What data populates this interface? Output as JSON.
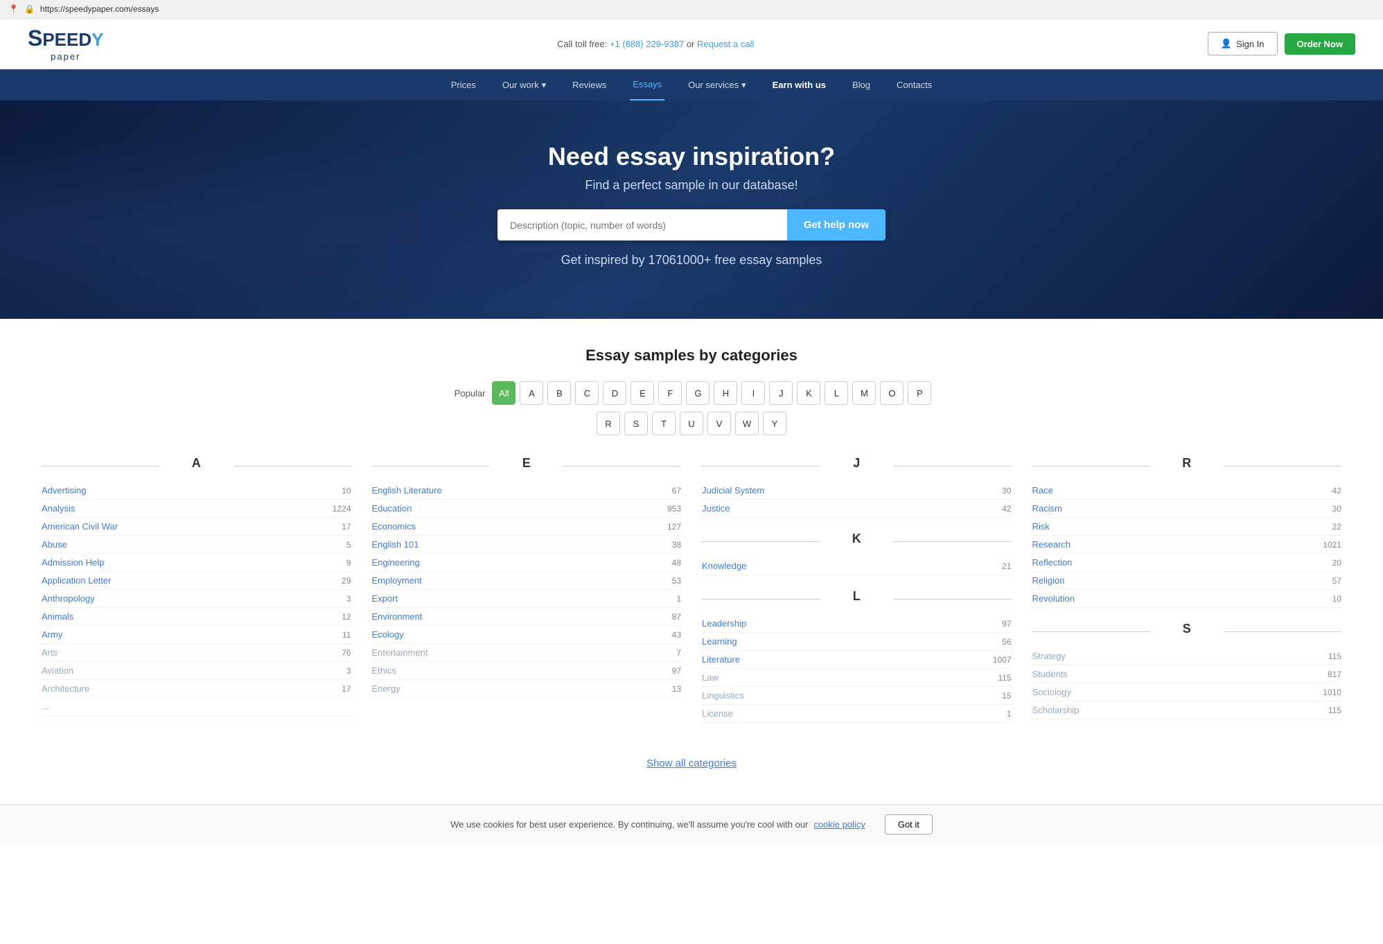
{
  "browser": {
    "url": "https://speedypaper.com/essays",
    "lock_icon": "🔒"
  },
  "header": {
    "logo_s": "S",
    "logo_peed": "PEED",
    "logo_ey": "Y",
    "logo_paper": "paper",
    "call_prefix": "Call toll free:",
    "phone": "+1 (888) 229-9387",
    "or": "or",
    "request_call": "Request a call",
    "signin_label": "Sign In",
    "order_label": "Order Now"
  },
  "nav": {
    "items": [
      {
        "label": "Prices",
        "href": "#",
        "active": false
      },
      {
        "label": "Our work",
        "href": "#",
        "active": false,
        "dropdown": true
      },
      {
        "label": "Reviews",
        "href": "#",
        "active": false
      },
      {
        "label": "Essays",
        "href": "#",
        "active": true
      },
      {
        "label": "Our services",
        "href": "#",
        "active": false,
        "dropdown": true
      },
      {
        "label": "Earn with us",
        "href": "#",
        "active": false,
        "special": true
      },
      {
        "label": "Blog",
        "href": "#",
        "active": false
      },
      {
        "label": "Contacts",
        "href": "#",
        "active": false
      }
    ]
  },
  "hero": {
    "title": "Need essay inspiration?",
    "subtitle": "Find a perfect sample in our database!",
    "search_placeholder": "Description (topic, number of words)",
    "search_button": "Get help now",
    "stat_text": "Get inspired by 17061000+ free essay samples"
  },
  "categories_section": {
    "title": "Essay samples by categories",
    "filter_label": "Popular",
    "filter_buttons_row1": [
      "All",
      "A",
      "B",
      "C",
      "D",
      "E",
      "F",
      "G",
      "H",
      "I",
      "J",
      "K",
      "L",
      "M",
      "O",
      "P"
    ],
    "filter_buttons_row2": [
      "R",
      "S",
      "T",
      "U",
      "V",
      "W",
      "Y"
    ],
    "active_filter": "All"
  },
  "columns": {
    "A": {
      "letter": "A",
      "items": [
        {
          "label": "Advertising",
          "count": "10",
          "muted": false
        },
        {
          "label": "Analysis",
          "count": "1224",
          "muted": false
        },
        {
          "label": "American Civil War",
          "count": "17",
          "muted": false
        },
        {
          "label": "Abuse",
          "count": "5",
          "muted": false
        },
        {
          "label": "Admission Help",
          "count": "9",
          "muted": false
        },
        {
          "label": "Application Letter",
          "count": "29",
          "muted": false
        },
        {
          "label": "Anthropology",
          "count": "3",
          "muted": false
        },
        {
          "label": "Animals",
          "count": "12",
          "muted": false
        },
        {
          "label": "Army",
          "count": "11",
          "muted": false
        },
        {
          "label": "Arts",
          "count": "76",
          "muted": true
        },
        {
          "label": "Aviation",
          "count": "3",
          "muted": true
        },
        {
          "label": "Architecture",
          "count": "17",
          "muted": true
        },
        {
          "label": "...",
          "count": "",
          "muted": true
        }
      ]
    },
    "E": {
      "letter": "E",
      "items": [
        {
          "label": "English Literature",
          "count": "67",
          "muted": false
        },
        {
          "label": "Education",
          "count": "953",
          "muted": false
        },
        {
          "label": "Economics",
          "count": "127",
          "muted": false
        },
        {
          "label": "English 101",
          "count": "38",
          "muted": false
        },
        {
          "label": "Engineering",
          "count": "48",
          "muted": false
        },
        {
          "label": "Employment",
          "count": "53",
          "muted": false
        },
        {
          "label": "Export",
          "count": "1",
          "muted": false
        },
        {
          "label": "Environment",
          "count": "87",
          "muted": false
        },
        {
          "label": "Ecology",
          "count": "43",
          "muted": false
        },
        {
          "label": "Entertainment",
          "count": "7",
          "muted": true
        },
        {
          "label": "Ethics",
          "count": "97",
          "muted": true
        },
        {
          "label": "Energy",
          "count": "13",
          "muted": true
        }
      ]
    },
    "J": {
      "letter": "J",
      "items": [
        {
          "label": "Judicial System",
          "count": "30",
          "muted": false
        },
        {
          "label": "Justice",
          "count": "42",
          "muted": false
        }
      ],
      "K": {
        "letter": "K",
        "items": [
          {
            "label": "Knowledge",
            "count": "21",
            "muted": false
          }
        ]
      },
      "L": {
        "letter": "L",
        "items": [
          {
            "label": "Leadership",
            "count": "97",
            "muted": false
          },
          {
            "label": "Learning",
            "count": "56",
            "muted": false
          },
          {
            "label": "Literature",
            "count": "1007",
            "muted": false
          },
          {
            "label": "Law",
            "count": "115",
            "muted": true
          },
          {
            "label": "Linguistics",
            "count": "15",
            "muted": true
          },
          {
            "label": "License",
            "count": "1",
            "muted": true
          }
        ]
      }
    },
    "R": {
      "letter": "R",
      "items": [
        {
          "label": "Race",
          "count": "42",
          "muted": false
        },
        {
          "label": "Racism",
          "count": "30",
          "muted": false
        },
        {
          "label": "Risk",
          "count": "22",
          "muted": false
        },
        {
          "label": "Research",
          "count": "1021",
          "muted": false
        },
        {
          "label": "Reflection",
          "count": "20",
          "muted": false
        },
        {
          "label": "Religion",
          "count": "57",
          "muted": false
        },
        {
          "label": "Revolution",
          "count": "10",
          "muted": false
        }
      ],
      "S": {
        "letter": "S",
        "items": [
          {
            "label": "Strategy",
            "count": "115",
            "muted": true
          },
          {
            "label": "Students",
            "count": "817",
            "muted": true
          },
          {
            "label": "Sociology",
            "count": "1010",
            "muted": true
          },
          {
            "label": "Scholarship",
            "count": "115",
            "muted": true
          }
        ]
      }
    }
  },
  "show_all": {
    "label": "Show all categories"
  },
  "cookie_bar": {
    "text": "We use cookies for best user experience. By continuing, we'll assume you're cool with our",
    "link_text": "cookie policy",
    "button_label": "Got it"
  }
}
